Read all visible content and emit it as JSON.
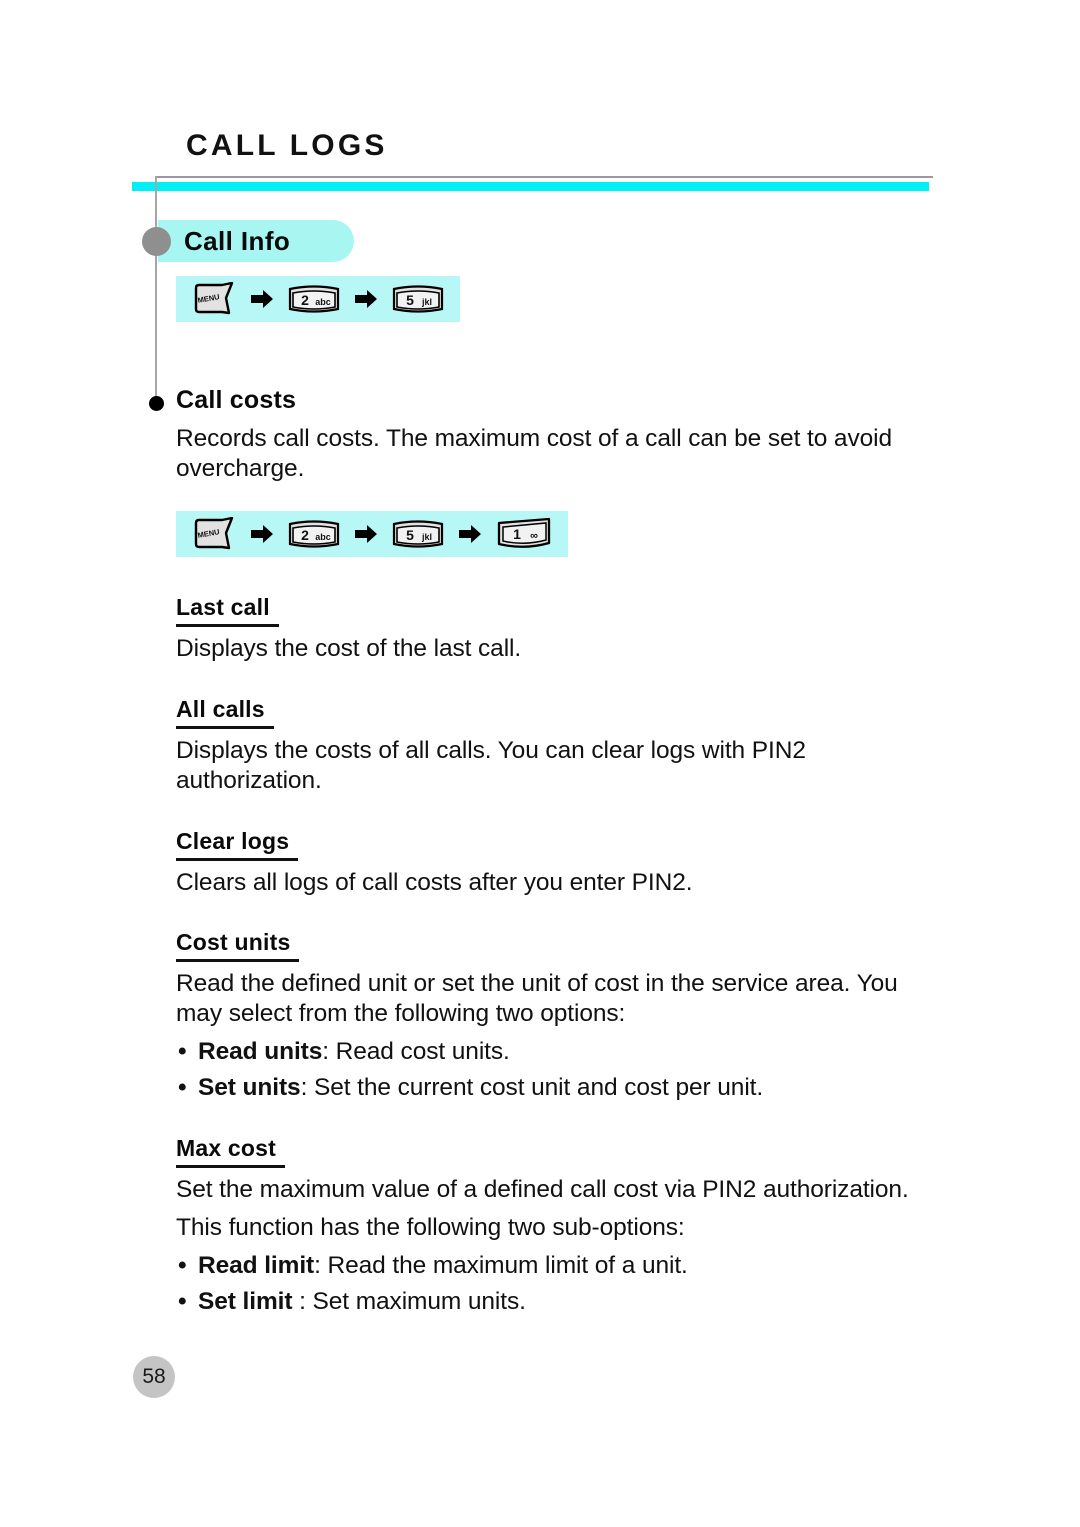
{
  "document": {
    "chapter_title": "CALL LOGS",
    "page_number": "58"
  },
  "colors": {
    "accent_bar": "#00f0f5",
    "pill_background": "#a8f6f2",
    "keyseq_background": "#b7f8f6",
    "rule_gray": "#9a9a9a",
    "node_gray": "#8f8f8f",
    "page_badge": "#c4c4c4",
    "text": "#111111"
  },
  "section": {
    "pill_label": "Call Info",
    "key_sequence": {
      "steps": [
        "MENU",
        "2 abc",
        "5 jkl"
      ],
      "separator": "arrow-right-icon"
    }
  },
  "feature": {
    "heading": "Call costs",
    "description": "Records call costs. The maximum cost of a call can be set to avoid overcharge.",
    "key_sequence": {
      "steps": [
        "MENU",
        "2 abc",
        "5 jkl",
        "1 ∞"
      ],
      "separator": "arrow-right-icon"
    }
  },
  "keys": {
    "menu": {
      "label": "MENU",
      "sub": ""
    },
    "two": {
      "label": "2",
      "sub": "abc"
    },
    "five": {
      "label": "5",
      "sub": "jkl"
    },
    "one": {
      "label": "1",
      "sub": "∞"
    }
  },
  "subsections": [
    {
      "heading": "Last call",
      "paragraphs": [
        "Displays the cost of the last call."
      ],
      "bullets": []
    },
    {
      "heading": "All calls",
      "paragraphs": [
        "Displays the costs of all calls. You can clear logs with PIN2 authorization."
      ],
      "bullets": []
    },
    {
      "heading": "Clear logs",
      "paragraphs": [
        "Clears all logs of call costs after you enter PIN2."
      ],
      "bullets": []
    },
    {
      "heading": "Cost units",
      "paragraphs": [
        "Read the defined unit or set the unit of cost in the service area. You may select from the following two options:"
      ],
      "bullets": [
        {
          "term": "Read units",
          "rest": ": Read cost units."
        },
        {
          "term": "Set units",
          "rest": ": Set the current cost unit and cost per unit."
        }
      ]
    },
    {
      "heading": "Max cost",
      "paragraphs": [
        "Set the maximum value of a defined call cost via PIN2 authorization.",
        "This function has the following two sub-options:"
      ],
      "bullets": [
        {
          "term": "Read limit",
          "rest": ": Read the maximum limit of a unit."
        },
        {
          "term": "Set limit ",
          "rest": ": Set maximum units."
        }
      ]
    }
  ]
}
